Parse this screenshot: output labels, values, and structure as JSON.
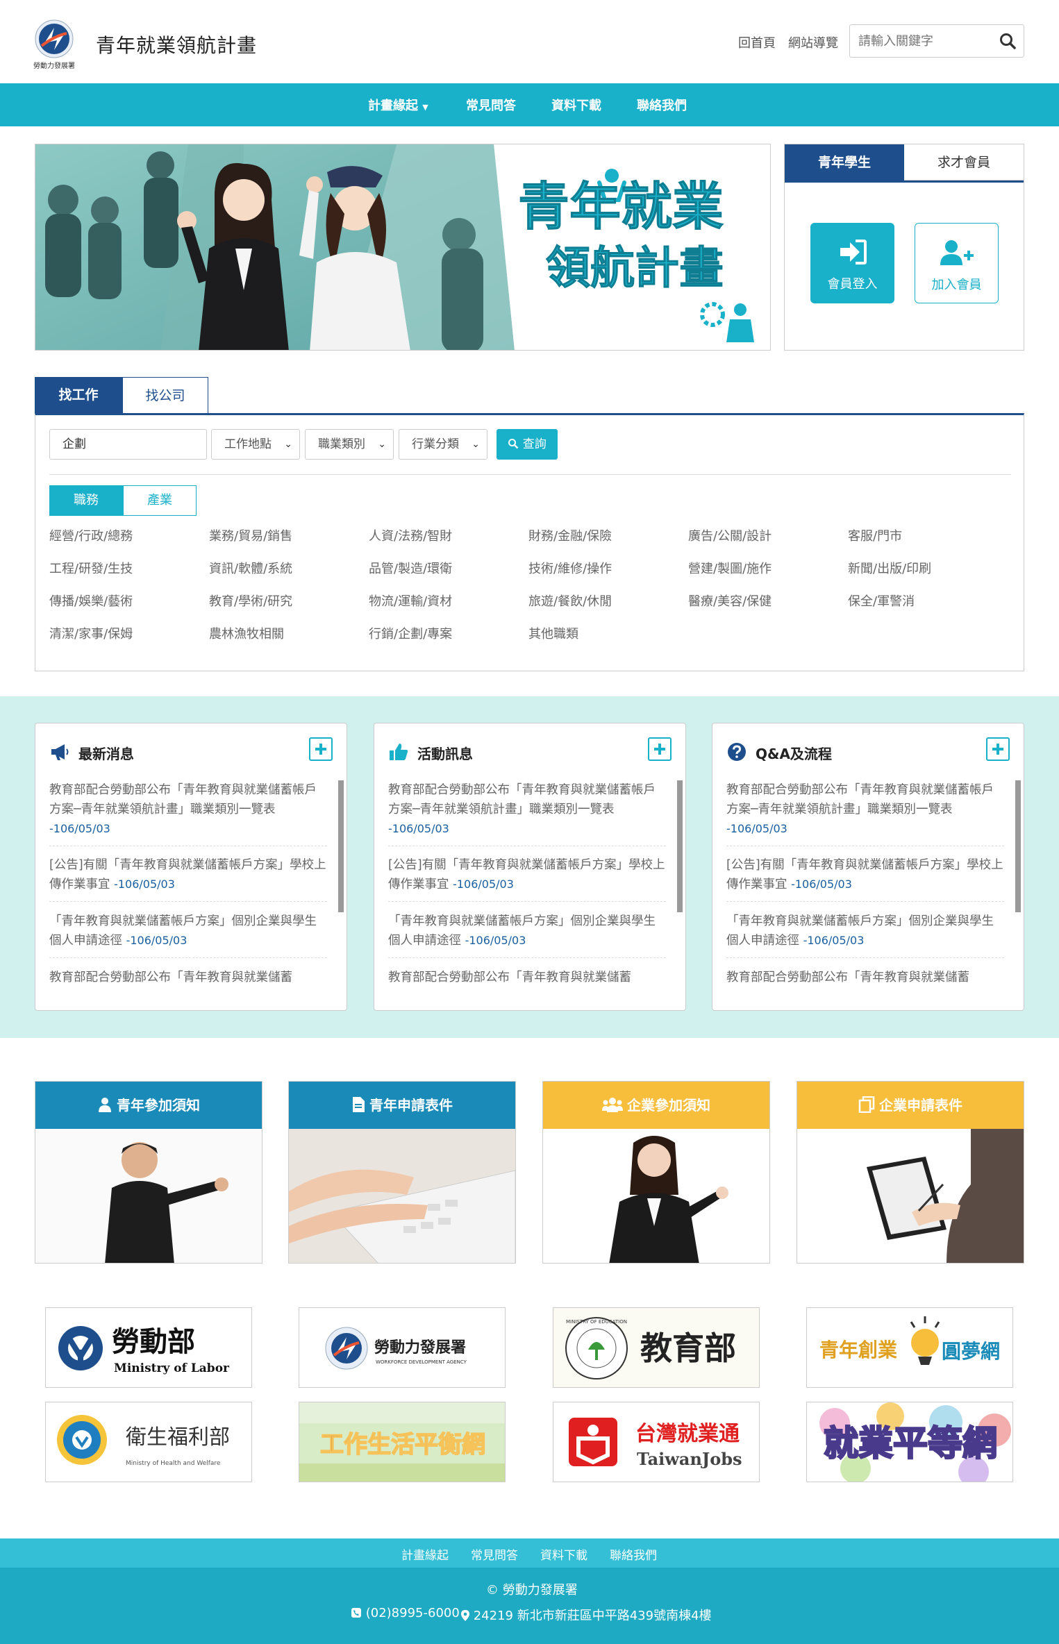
{
  "header": {
    "site_title": "青年就業領航計畫",
    "logo_caption": "勞動力發展署",
    "links": [
      "回首頁",
      "網站導覽"
    ],
    "search_placeholder": "請輸入關鍵字"
  },
  "nav": {
    "items": [
      "計畫緣起",
      "常見問答",
      "資料下載",
      "聯絡我們"
    ]
  },
  "banner": {
    "headline_1": "青年就業",
    "headline_2": "領航計畫"
  },
  "member": {
    "tabs": [
      "青年學生",
      "求才會員"
    ],
    "login_label": "會員登入",
    "join_label": "加入會員"
  },
  "job_search": {
    "tabs": [
      "找工作",
      "找公司"
    ],
    "keyword_value": "企劃",
    "location_select": "工作地點",
    "occupation_select": "職業類別",
    "industry_select": "行業分類",
    "search_button": "查詢",
    "segments": [
      "職務",
      "產業"
    ],
    "categories": [
      [
        "經營/行政/總務",
        "業務/貿易/銷售",
        "人資/法務/智財",
        "財務/金融/保險",
        "廣告/公關/設計",
        "客服/門市"
      ],
      [
        "工程/研發/生技",
        "資訊/軟體/系統",
        "品管/製造/環衛",
        "技術/維修/操作",
        "營建/製圖/施作",
        "新聞/出版/印刷"
      ],
      [
        "傳播/娛樂/藝術",
        "教育/學術/研究",
        "物流/運輸/資材",
        "旅遊/餐飲/休閒",
        "醫療/美容/保健",
        "保全/軍警消"
      ],
      [
        "清潔/家事/保姆",
        "農林漁牧相關",
        "行銷/企劃/專案",
        "其他職類"
      ]
    ]
  },
  "news_cards": [
    {
      "title": "最新消息",
      "items": [
        {
          "text": "教育部配合勞動部公布「青年教育與就業儲蓄帳戶方案─青年就業領航計畫」職業類別一覽表",
          "date": "-106/05/03"
        },
        {
          "text": "[公告]有關「青年教育與就業儲蓄帳戶方案」學校上傳作業事宜",
          "date": "-106/05/03"
        },
        {
          "text": "「青年教育與就業儲蓄帳戶方案」個別企業與學生個人申請途徑",
          "date": "-106/05/03"
        },
        {
          "text": "教育部配合勞動部公布「青年教育與就業儲蓄",
          "date": ""
        }
      ]
    },
    {
      "title": "活動訊息",
      "items": [
        {
          "text": "教育部配合勞動部公布「青年教育與就業儲蓄帳戶方案─青年就業領航計畫」職業類別一覽表",
          "date": "-106/05/03"
        },
        {
          "text": "[公告]有關「青年教育與就業儲蓄帳戶方案」學校上傳作業事宜",
          "date": "-106/05/03"
        },
        {
          "text": "「青年教育與就業儲蓄帳戶方案」個別企業與學生個人申請途徑",
          "date": "-106/05/03"
        },
        {
          "text": "教育部配合勞動部公布「青年教育與就業儲蓄",
          "date": ""
        }
      ]
    },
    {
      "title": "Q&A及流程",
      "items": [
        {
          "text": "教育部配合勞動部公布「青年教育與就業儲蓄帳戶方案─青年就業領航計畫」職業類別一覽表",
          "date": "-106/05/03"
        },
        {
          "text": "[公告]有關「青年教育與就業儲蓄帳戶方案」學校上傳作業事宜",
          "date": "-106/05/03"
        },
        {
          "text": "「青年教育與就業儲蓄帳戶方案」個別企業與學生個人申請途徑",
          "date": "-106/05/03"
        },
        {
          "text": "教育部配合勞動部公布「青年教育與就業儲蓄",
          "date": ""
        }
      ]
    }
  ],
  "info_cards": [
    {
      "title": "青年參加須知",
      "color": "#1a8bb8"
    },
    {
      "title": "青年申請表件",
      "color": "#1a8bb8"
    },
    {
      "title": "企業參加須知",
      "color": "#f7be3b"
    },
    {
      "title": "企業申請表件",
      "color": "#f7be3b"
    }
  ],
  "partners": [
    {
      "name": "勞動部",
      "sub": "Ministry of Labor"
    },
    {
      "name": "勞動力發展署",
      "sub": "WORKFORCE DEVELOPMENT AGENCY"
    },
    {
      "name": "教育部",
      "sub": "MINISTRY OF EDUCATION"
    },
    {
      "name": "青年創業",
      "sub": "圓夢網"
    },
    {
      "name": "衛生福利部",
      "sub": "Ministry of Health and Welfare"
    },
    {
      "name": "工作生活平衡網",
      "sub": ""
    },
    {
      "name": "台灣就業通",
      "sub": "TaiwanJobs"
    },
    {
      "name": "就業平等網",
      "sub": ""
    }
  ],
  "footer": {
    "links": [
      "計畫緣起",
      "常見問答",
      "資料下載",
      "聯絡我們"
    ],
    "copyright": "© 勞動力發展署",
    "phone": "(02)8995-6000",
    "address": "24219 新北市新莊區中平路439號南棟4樓"
  },
  "colors": {
    "accent": "#19b0c9",
    "navy": "#1e4f8c",
    "band": "#d1f1ef",
    "gold": "#f7be3b"
  }
}
